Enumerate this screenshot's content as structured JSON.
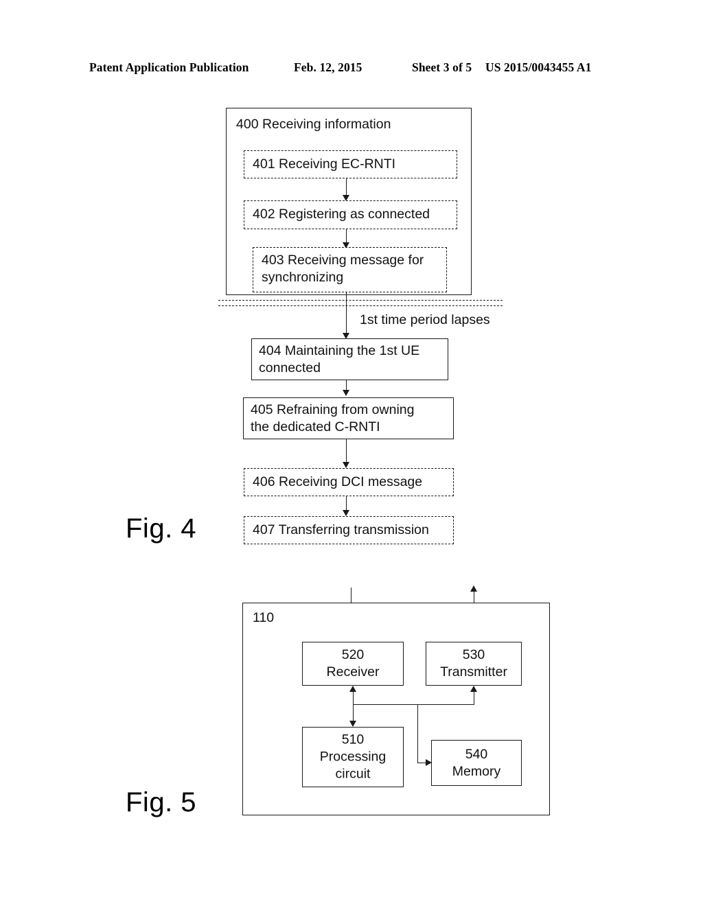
{
  "header": {
    "publication": "Patent Application Publication",
    "date": "Feb. 12, 2015",
    "sheet": "Sheet 3 of 5",
    "doc_number": "US 2015/0043455 A1"
  },
  "figure4": {
    "caption": "Fig. 4",
    "outer_box": {
      "label": "400 Receiving information"
    },
    "steps": [
      {
        "id": "401",
        "label": "401 Receiving EC-RNTI",
        "style": "dashed"
      },
      {
        "id": "402",
        "label": "402 Registering as connected",
        "style": "dashed"
      },
      {
        "id": "403",
        "label": "403 Receiving message for\nsynchronizing",
        "style": "dashed"
      },
      {
        "id": "404",
        "label": "404 Maintaining the 1st UE\nconnected",
        "style": "solid"
      },
      {
        "id": "405",
        "label": "405 Refraining from owning\nthe dedicated C-RNTI",
        "style": "solid"
      },
      {
        "id": "406",
        "label": "406 Receiving DCI message",
        "style": "dashed"
      },
      {
        "id": "407",
        "label": "407 Transferring transmission",
        "style": "dashed"
      }
    ],
    "annotation": "1st time period lapses"
  },
  "figure5": {
    "caption": "Fig. 5",
    "outer_box_ref": "110",
    "blocks": [
      {
        "id": "520",
        "ref": "520",
        "name": "Receiver",
        "label": "520\nReceiver"
      },
      {
        "id": "530",
        "ref": "530",
        "name": "Transmitter",
        "label": "530\nTransmitter"
      },
      {
        "id": "510",
        "ref": "510",
        "name": "Processing circuit",
        "label": "510\nProcessing\ncircuit"
      },
      {
        "id": "540",
        "ref": "540",
        "name": "Memory",
        "label": "540\nMemory"
      }
    ]
  },
  "colors": {
    "ink": "#1a1a1a",
    "paper": "#ffffff"
  }
}
